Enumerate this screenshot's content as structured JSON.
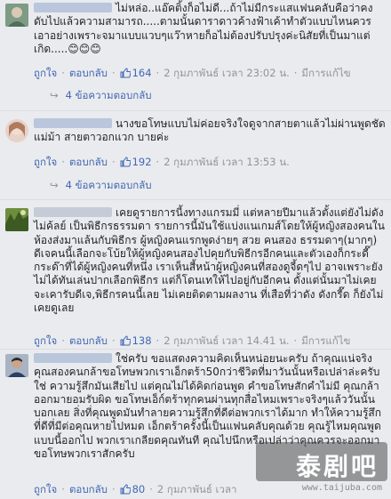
{
  "ui": {
    "like_label": "ถูกใจ",
    "reply_label": "ตอบกลับ",
    "edited_label": "มีการแก้ไข",
    "reply_arrow": "↪"
  },
  "comments": [
    {
      "text": "ไม่หล่อ..แอ๊คติ้งก็อไม่ดี...ถ้าไม่มีกระแสแฟนคลับคือว่าคงดับไปแล้วความสามารถ.....ตามนั้นดาราดาวค้างฟ้าเค้าทำตัวแบบไหนควรเอาอย่างเพราะจมาแบบแวบๆแว๊าหายก็อไม่ต้องปรับปรุงค่ะนิสัยที่เป็นมาแต่เกิด.....😊😊😊",
      "likes": "164",
      "date": "2 กุมภาพันธ์ เวลา 23:02 น.",
      "edited": true,
      "replies": "4 ข้อความตอบกลับ"
    },
    {
      "text": "นางขอโทษแบบไม่ค่อยจริงใจดูจากสายตาแล้วไม่ผ่านพูดชัดแม่ม้า สายตาวอกแวก บายค่ะ",
      "likes": "192",
      "date": "2 กุมภาพันธ์ เวลา 13:53 น.",
      "edited": false,
      "replies": "4 ข้อความตอบกลับ"
    },
    {
      "text": "เคยดูรายการนี้งทางแกรมมี่ แต่หลายปีมาแล้วตั้งแต่ยังไม่ดังไม่ค้ลย์ เป็นพิธีกรธรรมดา รายการนี้มันใช้แบ่งแนเกมส์โดยให้ผู้หญิงสองคนในห้องส่งมาแล้นกับพิธีกร ผู้หญิงคนแรกพูดง่ายๆ สวย คนสอง ธรรมดาๆ(มากๆ) ดีเจคนนี้เลือกจะโบ้ยให้ผู้หญิงคนสองไปคุยกับพิธีกรอีกคนและตัวเองก็กระดี๊กระด๊าที่ได้ผู้หญิงคนที่หนึ่ง เราเห็นสี้หน้าผู้หญิงคนที่สองดูจี้ดๆไป อาจเพราะยังไม่ได้ทันเล่นปากเลือกพิธีกร แต่ก็โดนเทให้ไปอยู่กับอีกคน ดั้งแต่นั้นมาไม่เคยจะเคารับดีเจ,พิธีกรคนนี้เลย ไม่เคยติดตามผลงาน ที่เสือที่ว่าดัง ดังกรี๊ด ก็ยังไม่เคยดูเลย",
      "likes": "138",
      "date": "2 กุมภาพันธ์ เวลา 14.41 น.",
      "edited": true
    },
    {
      "text": "ใช่ครับ ขอแสดงความคิดเห็นหน่อยนะครับ ถ้าคุณแน่จริง คุณสองคนกล้าขอโทษพวกเราเอ็กตร้า50กว่าชีวิตที่มาวันนั้นหรือเปล่าล่ะครับ ใช่ ความรู้สึกมันเสียไป แต่คุณไม่ได้คิดก่อนพูด คำขอโทษสักคำไม่มี คุณกล้าออกมายอมรับผิด ขอโทษเอ็ก์ตร้าทุกคนผ่านทุกสื่อไหมเพราะจริงๆแล้ววันนั้นบอกเลย สิ่งที่คุณพูดมันทำลายความรู้สึกที่ดีต่อพวกเราได้มาก ทำให้ความรู้สึกที่ดีที่มีต่อคุณหายไปหมด เอ็กตร้าครั้งนี้เป็นแฟนคลับคุณด้วย คุณรู้ไหมคุณพูดแบบนี้ออกไป พวกเราเกลียดคุณทันที คุณไปนึกหรือเปล่าว่าคุณควรจะออกมาขอโทษพวกเราสักครับ",
      "likes": "80",
      "date": "2 กุมภาพันธ์ เวลา",
      "edited": false
    }
  ],
  "watermark": {
    "title": "泰剧吧",
    "url": "www.taijuba.com"
  },
  "colors": {
    "link": "#4267b2",
    "meta": "#90949c",
    "background": "#e9ebee"
  }
}
